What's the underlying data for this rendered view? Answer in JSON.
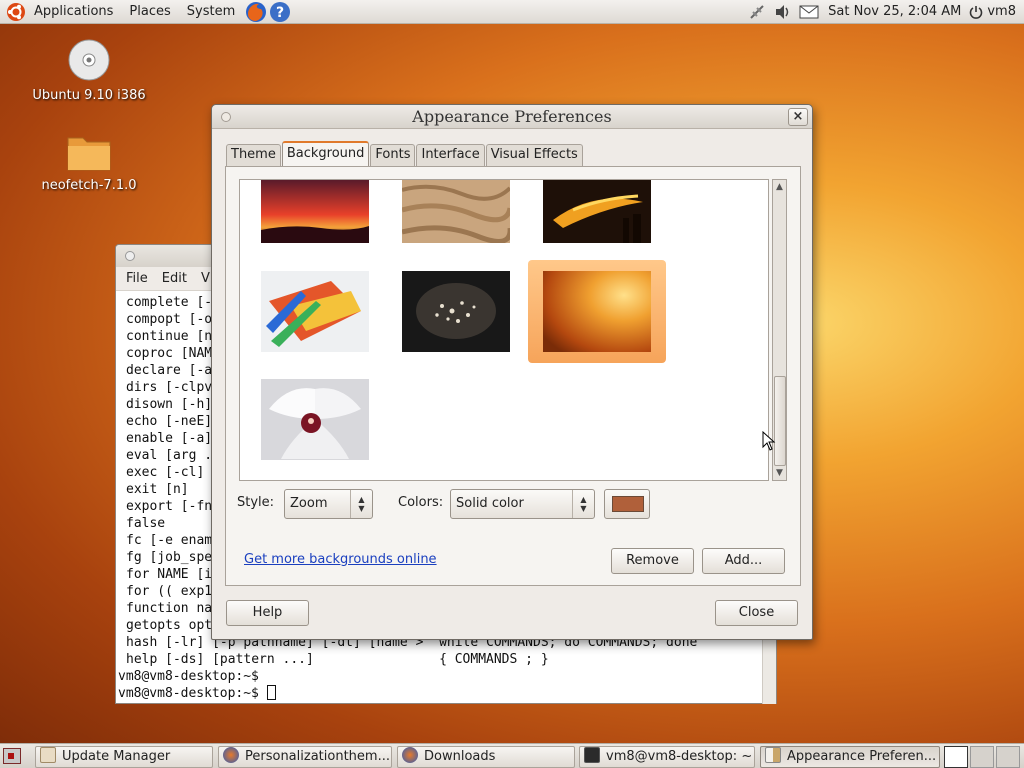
{
  "top_panel": {
    "menus": [
      "Applications",
      "Places",
      "System"
    ],
    "datetime": "Sat Nov 25,  2:04 AM",
    "user": "vm8"
  },
  "desktop_icons": [
    {
      "label": "Ubuntu 9.10 i386",
      "icon": "cd-disc-icon"
    },
    {
      "label": "neofetch-7.1.0",
      "icon": "folder-icon"
    }
  ],
  "terminal": {
    "menus": [
      "File",
      "Edit",
      "V"
    ],
    "lines": [
      "complete [-",
      "compopt [-o",
      "continue [n",
      "coproc [NAM",
      "declare [-a",
      "dirs [-clpv",
      "disown [-h]",
      "echo [-neE]",
      "enable [-a]",
      "eval [arg .",
      "exec [-cl]",
      "exit [n]",
      "export [-fn",
      "false",
      "fc [-e enam",
      "fg [job_spe",
      "for NAME [i",
      "for (( exp1",
      "function na",
      "getopts opt",
      "hash [-lr] [-p pathname] [-dt] [name >  while COMMANDS; do COMMANDS; done",
      "help [-ds] [pattern ...]                { COMMANDS ; }"
    ],
    "prompts": [
      "vm8@vm8-desktop:~$",
      "vm8@vm8-desktop:~$"
    ]
  },
  "dialog": {
    "title": "Appearance Preferences",
    "close_glyph": "×",
    "tabs": [
      "Theme",
      "Background",
      "Fonts",
      "Interface",
      "Visual Effects"
    ],
    "active_tab": "Background",
    "wallpapers": [
      {
        "name": "red-sunset-wallpaper"
      },
      {
        "name": "sand-dunes-wallpaper"
      },
      {
        "name": "dark-sunset-clouds-wallpaper"
      },
      {
        "name": "colored-pencils-wallpaper"
      },
      {
        "name": "water-droplets-wallpaper"
      },
      {
        "name": "orange-warty-wallpaper",
        "selected": true
      },
      {
        "name": "white-orchid-wallpaper"
      }
    ],
    "style_label": "Style:",
    "style_value": "Zoom",
    "colors_label": "Colors:",
    "colors_value": "Solid color",
    "color_swatch": "#b0603a",
    "link_text": "Get more backgrounds online",
    "remove_label": "Remove",
    "add_label": "Add...",
    "help_label": "Help",
    "close_label": "Close"
  },
  "taskbar": {
    "tasks": [
      {
        "label": "Update Manager",
        "icon": "update-manager-icon"
      },
      {
        "label": "Personalizationthem...",
        "icon": "firefox-icon"
      },
      {
        "label": "Downloads",
        "icon": "firefox-icon"
      },
      {
        "label": "vm8@vm8-desktop: ~",
        "icon": "terminal-icon"
      },
      {
        "label": "Appearance Preferen...",
        "icon": "appearance-icon",
        "active": true
      }
    ]
  },
  "colors": {
    "accent": "#e07a2c",
    "link": "#1a3fbf"
  }
}
